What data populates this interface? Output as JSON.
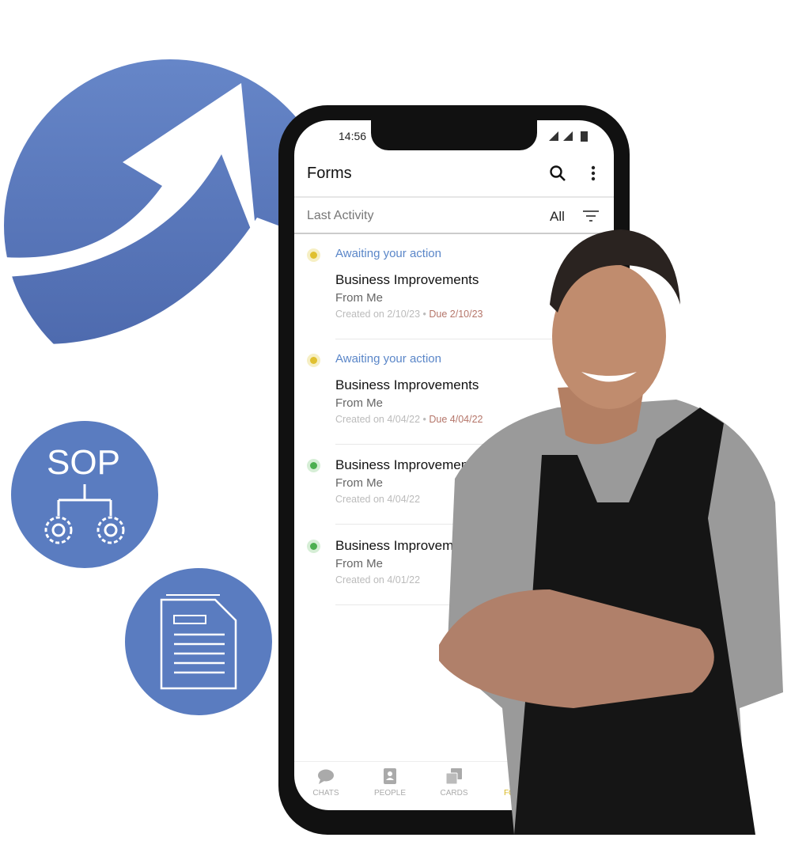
{
  "status_bar": {
    "time": "14:56"
  },
  "header": {
    "title": "Forms",
    "search_icon": "search-icon",
    "menu_icon": "more-vertical-icon"
  },
  "filter_bar": {
    "sort_label": "Last Activity",
    "filter_value": "All",
    "filter_icon": "filter-icon"
  },
  "items": [
    {
      "status": "Awaiting your action",
      "title": "Business Improvements",
      "from": "From Me",
      "created": "Created on 2/10/23",
      "due": "Due 2/10/23",
      "dot_color": "#e0c030"
    },
    {
      "status": "Awaiting your action",
      "title": "Business Improvements",
      "from": "From Me",
      "created": "Created on 4/04/22",
      "due": "Due 4/04/22",
      "dot_color": "#e0c030"
    },
    {
      "title": "Business Improvements",
      "from": "From Me",
      "created": "Created on 4/04/22",
      "dot_color": "#4caf50"
    },
    {
      "title": "Business Improvements",
      "from": "From Me",
      "created": "Created on 4/01/22",
      "dot_color": "#4caf50"
    }
  ],
  "bottom_nav": [
    {
      "label": "CHATS",
      "icon": "chat-icon"
    },
    {
      "label": "PEOPLE",
      "icon": "contacts-icon"
    },
    {
      "label": "CARDS",
      "icon": "cards-icon"
    },
    {
      "label": "FORMS",
      "icon": "forms-icon",
      "active": true
    }
  ],
  "badges": {
    "sop_label": "SOP"
  },
  "colors": {
    "brand_blue": "#5a7cc0",
    "accent_yellow": "#e0c030",
    "status_green": "#4caf50"
  }
}
